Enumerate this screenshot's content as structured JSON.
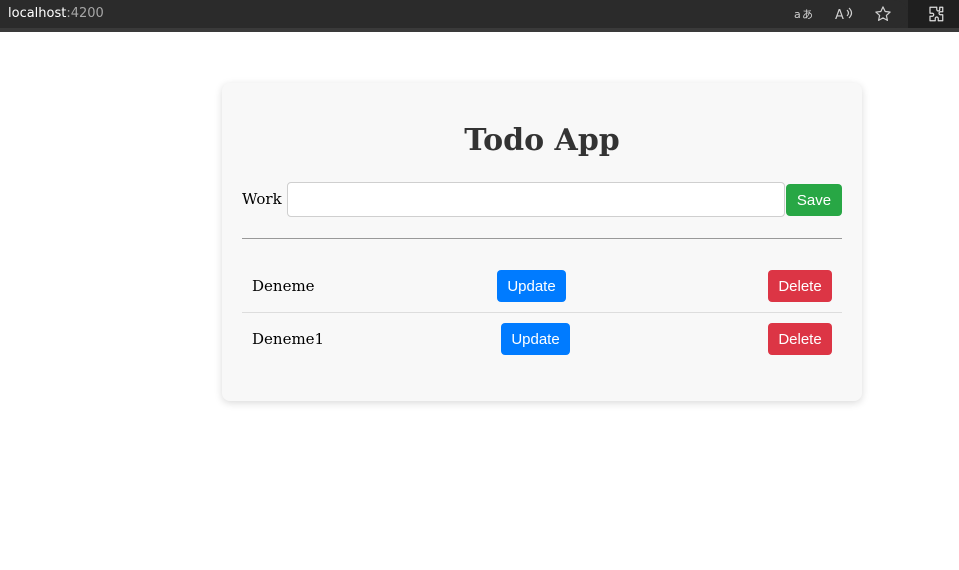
{
  "browser": {
    "host": "localhost",
    "port": ":4200",
    "icons": [
      "translate-icon",
      "read-aloud-icon",
      "favorite-star-icon",
      "extensions-icon"
    ]
  },
  "app": {
    "title": "Todo App",
    "work_label": "Work",
    "work_value": "",
    "save_label": "Save"
  },
  "todos": [
    {
      "text": "Deneme",
      "update_label": "Update",
      "delete_label": "Delete"
    },
    {
      "text": "Deneme1",
      "update_label": "Update",
      "delete_label": "Delete"
    }
  ],
  "colors": {
    "save": "#28a745",
    "update": "#007bff",
    "delete": "#dc3545"
  }
}
